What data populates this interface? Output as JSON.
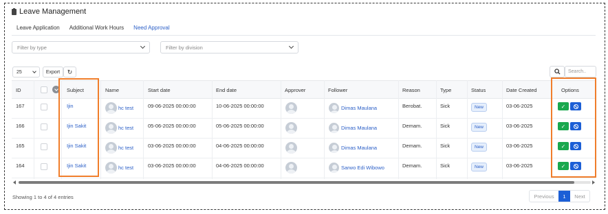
{
  "page": {
    "title": "Leave Management"
  },
  "tabs": [
    {
      "label": "Leave Application"
    },
    {
      "label": "Additional Work Hours"
    },
    {
      "label": "Need Approval"
    }
  ],
  "filters": {
    "type_placeholder": "Filter by type",
    "division_placeholder": "Filter by division"
  },
  "toolbar": {
    "page_size": "25",
    "export_label": "Export",
    "refresh_glyph": "↻",
    "search_placeholder": "Search.."
  },
  "table": {
    "headers": {
      "id": "ID",
      "subject": "Subject",
      "name": "Name",
      "start": "Start date",
      "end": "End date",
      "approver": "Approver",
      "follower": "Follower",
      "reason": "Reason",
      "type": "Type",
      "status": "Status",
      "created": "Date Created",
      "options": "Options"
    },
    "rows": [
      {
        "id": "167",
        "subject": "Ijin",
        "name": "hc test",
        "start": "09-06-2025 00:00:00",
        "end": "10-06-2025 00:00:00",
        "follower": "Dimas Maulana",
        "reason": "Berobat.",
        "type": "Sick",
        "status": "New",
        "created": "03-06-2025"
      },
      {
        "id": "166",
        "subject": "Ijin Sakit",
        "name": "hc test",
        "start": "05-06-2025 00:00:00",
        "end": "05-06-2025 00:00:00",
        "follower": "Dimas Maulana",
        "reason": "Demam.",
        "type": "Sick",
        "status": "New",
        "created": "03-06-2025"
      },
      {
        "id": "165",
        "subject": "Ijin Sakit",
        "name": "hc test",
        "start": "03-06-2025 00:00:00",
        "end": "04-06-2025 00:00:00",
        "follower": "Dimas Maulana",
        "reason": "Demam.",
        "type": "Sick",
        "status": "New",
        "created": "03-06-2025"
      },
      {
        "id": "164",
        "subject": "Ijin Sakit",
        "name": "hc test",
        "start": "03-06-2025 00:00:00",
        "end": "04-06-2025 00:00:00",
        "follower": "Sarwo Edi Wibowo",
        "reason": "Demam.",
        "type": "Sick",
        "status": "New",
        "created": "03-06-2025"
      }
    ]
  },
  "footer": {
    "showing": "Showing 1 to 4 of 4 entries",
    "prev": "Previous",
    "current_page": "1",
    "next": "Next"
  },
  "colors": {
    "accent": "#2b5fc7",
    "approve": "#1aa84e",
    "reject": "#1c5fd6",
    "highlight": "#f07d2a"
  }
}
